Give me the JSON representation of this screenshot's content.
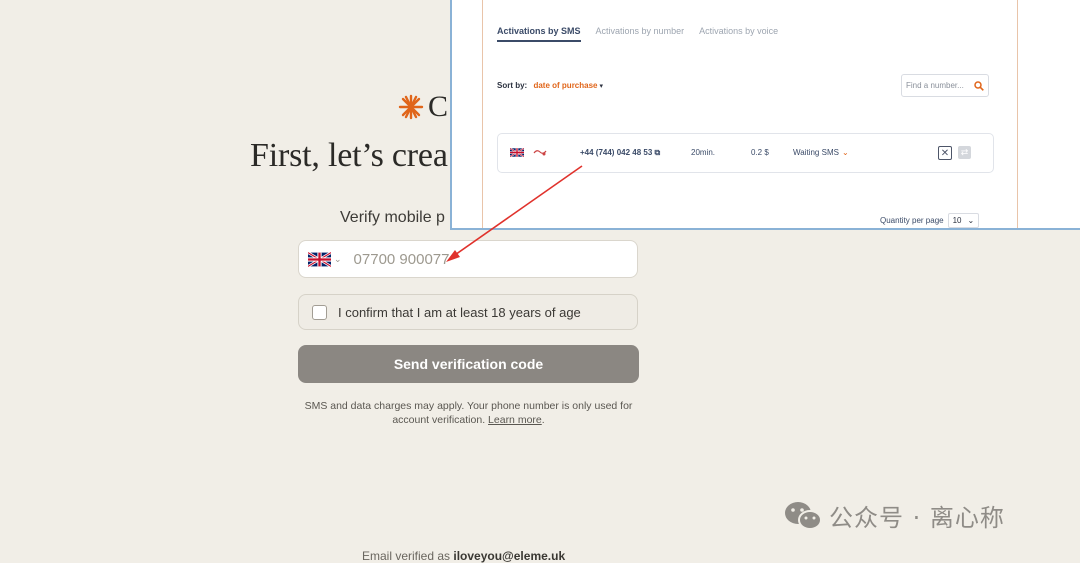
{
  "signup": {
    "logo_text": "C",
    "headline": "First, let’s crea",
    "verify_label": "Verify mobile p",
    "phone_placeholder": "07700 900077",
    "age_confirm": "I confirm that I am at least 18 years of age",
    "send_button": "Send verification code",
    "disclaimer": "SMS and data charges may apply. Your phone number is only used for account verification.",
    "learn_more": "Learn more",
    "email_prefix": "Email verified as ",
    "email": "iloveyou@eleme.uk"
  },
  "sms_panel": {
    "tabs": [
      "Activations by SMS",
      "Activations by number",
      "Activations by voice"
    ],
    "sort_label": "Sort by:",
    "sort_value": "date of purchase",
    "find_placeholder": "Find a number...",
    "row": {
      "number": "+44 (744) 042 48 53",
      "time": "20min.",
      "price": "0.2 $",
      "status": "Waiting SMS"
    },
    "qty_label": "Quantity per page",
    "qty_value": "10"
  },
  "watermark": {
    "text": "公众号 · 离心称"
  },
  "colors": {
    "background": "#f1eee7",
    "accent_orange": "#e0651a",
    "button_gray": "#8b8782",
    "arrow_red": "#e0322c"
  }
}
